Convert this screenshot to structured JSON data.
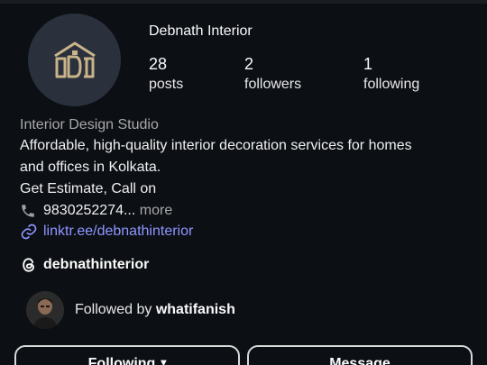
{
  "profile": {
    "name": "Debnath Interior",
    "stats": [
      {
        "value": "28",
        "label": "posts"
      },
      {
        "value": "2",
        "label": "followers"
      },
      {
        "value": "1",
        "label": "following"
      }
    ]
  },
  "bio": {
    "category": "Interior Design Studio",
    "lines": [
      "Affordable, high-quality interior decoration services for homes",
      "and offices in Kolkata.",
      "Get Estimate, Call on"
    ],
    "phone": "9830252274...",
    "more": "more",
    "link": "linktr.ee/debnathinterior"
  },
  "threads": {
    "handle": "debnathinterior"
  },
  "followed_by": {
    "prefix": "Followed by",
    "username": "whatifanish"
  },
  "buttons": {
    "following": "Following",
    "message": "Message"
  },
  "colors": {
    "background": "#0c0f14",
    "link": "#8e96ff",
    "avatar_bg": "#2a303c",
    "logo": "#c9b48a"
  }
}
